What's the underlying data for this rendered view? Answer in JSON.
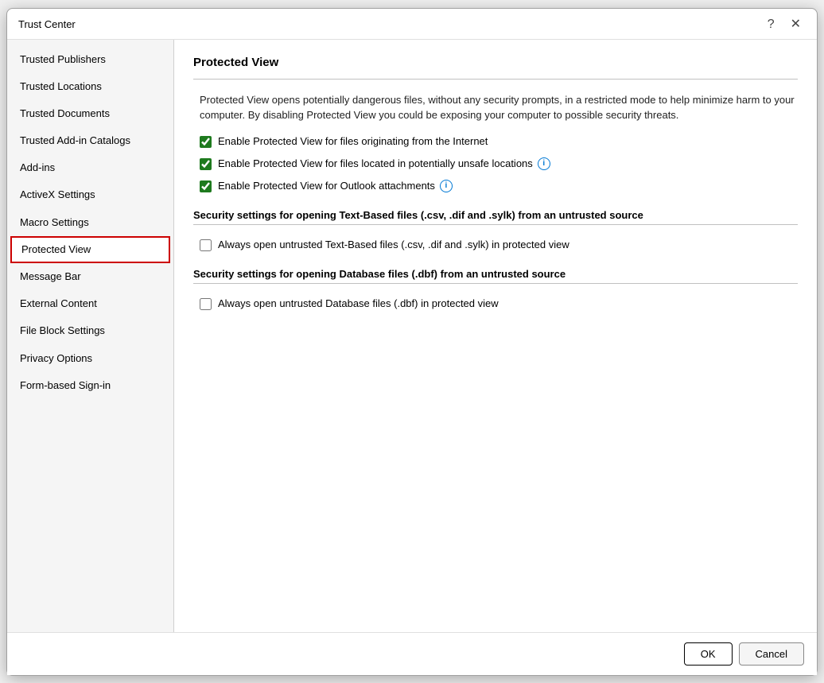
{
  "dialog": {
    "title": "Trust Center",
    "help_icon": "?",
    "close_icon": "✕"
  },
  "sidebar": {
    "items": [
      {
        "id": "trusted-publishers",
        "label": "Trusted Publishers",
        "active": false
      },
      {
        "id": "trusted-locations",
        "label": "Trusted Locations",
        "active": false
      },
      {
        "id": "trusted-documents",
        "label": "Trusted Documents",
        "active": false
      },
      {
        "id": "trusted-add-in-catalogs",
        "label": "Trusted Add-in Catalogs",
        "active": false
      },
      {
        "id": "add-ins",
        "label": "Add-ins",
        "active": false
      },
      {
        "id": "activex-settings",
        "label": "ActiveX Settings",
        "active": false
      },
      {
        "id": "macro-settings",
        "label": "Macro Settings",
        "active": false
      },
      {
        "id": "protected-view",
        "label": "Protected View",
        "active": true
      },
      {
        "id": "message-bar",
        "label": "Message Bar",
        "active": false
      },
      {
        "id": "external-content",
        "label": "External Content",
        "active": false
      },
      {
        "id": "file-block-settings",
        "label": "File Block Settings",
        "active": false
      },
      {
        "id": "privacy-options",
        "label": "Privacy Options",
        "active": false
      },
      {
        "id": "form-based-sign-in",
        "label": "Form-based Sign-in",
        "active": false
      }
    ]
  },
  "main": {
    "section_title": "Protected View",
    "description": "Protected View opens potentially dangerous files, without any security prompts, in a restricted mode to help minimize harm to your computer. By disabling Protected View you could be exposing your computer to possible security threats.",
    "checkboxes": [
      {
        "id": "cb-internet",
        "label": "Enable Protected View for files originating from the Internet",
        "checked": true,
        "has_info": false
      },
      {
        "id": "cb-unsafe-locations",
        "label": "Enable Protected View for files located in potentially unsafe locations",
        "checked": true,
        "has_info": true
      },
      {
        "id": "cb-outlook",
        "label": "Enable Protected View for Outlook attachments",
        "checked": true,
        "has_info": true
      }
    ],
    "text_based_section": {
      "header": "Security settings for opening Text-Based files (.csv, .dif and .sylk) from an untrusted source",
      "checkbox_label": "Always open untrusted Text-Based files (.csv, .dif and .sylk) in protected view",
      "checked": false
    },
    "database_section": {
      "header": "Security settings for opening Database files (.dbf) from an untrusted source",
      "checkbox_label": "Always open untrusted Database files (.dbf) in protected view",
      "checked": false
    }
  },
  "footer": {
    "ok_label": "OK",
    "cancel_label": "Cancel"
  }
}
